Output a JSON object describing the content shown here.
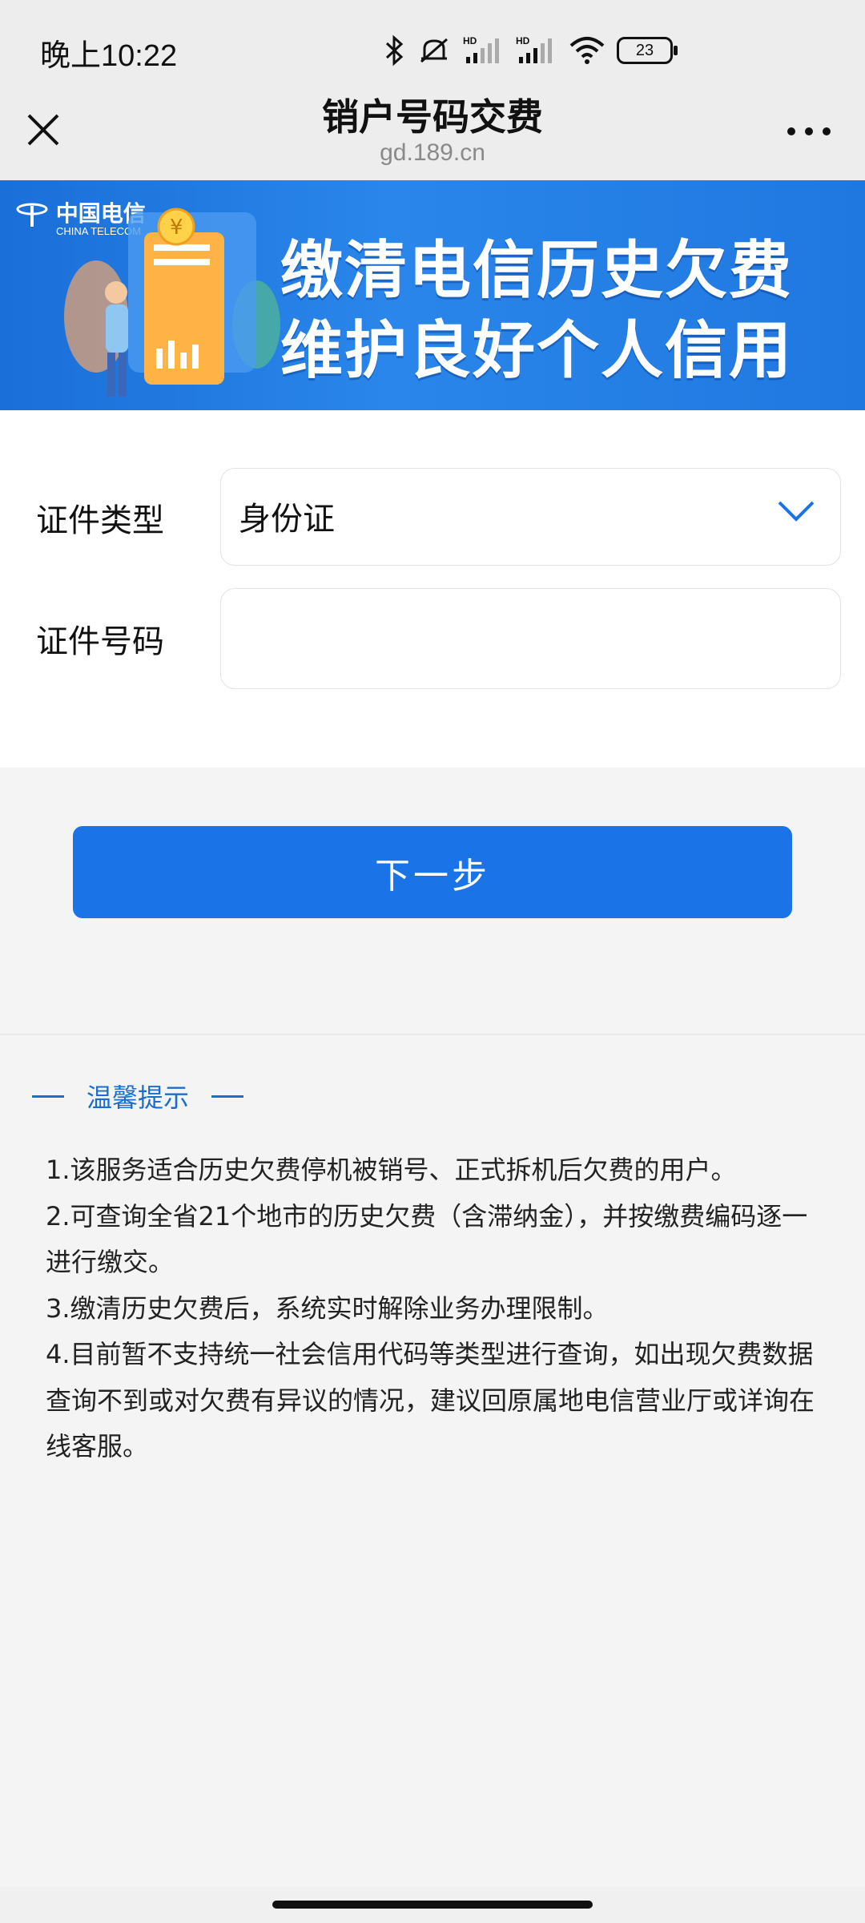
{
  "status": {
    "time": "晚上10:22",
    "battery": "23",
    "icons": [
      "bluetooth-icon",
      "mute-icon",
      "signal-hd-icon",
      "signal-hd-icon",
      "wifi-icon",
      "battery-icon"
    ]
  },
  "nav": {
    "title": "销户号码交费",
    "subtitle": "gd.189.cn",
    "close_icon": "close-icon",
    "more_icon": "more-icon"
  },
  "banner": {
    "logo_cn": "中国电信",
    "logo_en": "CHINA TELECOM",
    "line1": "缴清电信历史欠费",
    "line2": "维护良好个人信用"
  },
  "form": {
    "id_type_label": "证件类型",
    "id_type_value": "身份证",
    "id_number_label": "证件号码",
    "id_number_value": "",
    "id_number_placeholder": ""
  },
  "actions": {
    "next_label": "下一步"
  },
  "tips": {
    "title": "温馨提示",
    "items": [
      "1.该服务适合历史欠费停机被销号、正式拆机后欠费的用户。",
      "2.可查询全省21个地市的历史欠费（含滞纳金），并按缴费编码逐一进行缴交。",
      "3.缴清历史欠费后，系统实时解除业务办理限制。",
      "4.目前暂不支持统一社会信用代码等类型进行查询，如出现欠费数据查询不到或对欠费有异议的情况，建议回原属地电信营业厅或详询在线客服。"
    ]
  },
  "colors": {
    "accent": "#1b73e8",
    "tips_title": "#1a6ecf",
    "banner_bg": "#2a86ea"
  }
}
